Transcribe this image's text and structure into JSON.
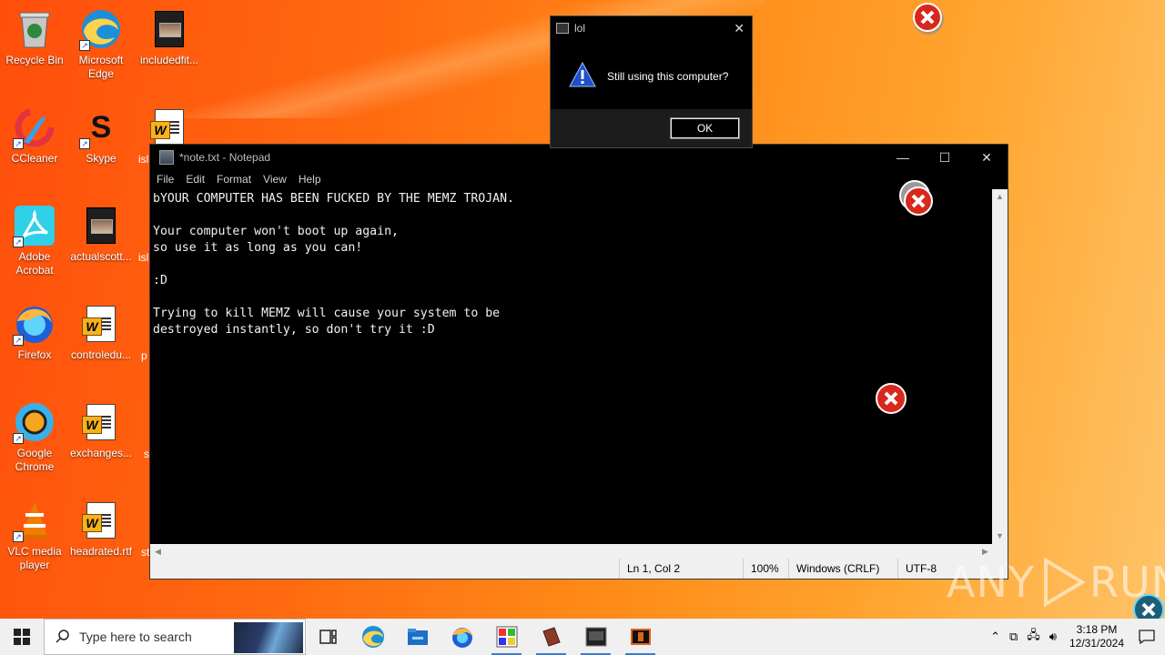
{
  "desktop": {
    "icons": [
      {
        "label": "Recycle Bin",
        "icon": "recycle-bin-icon"
      },
      {
        "label": "Microsoft Edge",
        "icon": "edge-icon"
      },
      {
        "label": "includedfit...",
        "icon": "image-file-icon"
      },
      {
        "label": "CCleaner",
        "icon": "ccleaner-icon"
      },
      {
        "label": "Skype",
        "icon": "skype-icon"
      },
      {
        "label": "isl",
        "icon": "word-doc-icon"
      },
      {
        "label": "Adobe Acrobat",
        "icon": "acrobat-icon"
      },
      {
        "label": "actualscott...",
        "icon": "image-file-icon"
      },
      {
        "label": "isl",
        "icon": "partial-icon"
      },
      {
        "label": "Firefox",
        "icon": "firefox-icon"
      },
      {
        "label": "controledu...",
        "icon": "word-doc-icon"
      },
      {
        "label": "p",
        "icon": "partial-icon"
      },
      {
        "label": "Google Chrome",
        "icon": "chrome-icon"
      },
      {
        "label": "exchanges...",
        "icon": "word-doc-icon"
      },
      {
        "label": "s",
        "icon": "partial-icon"
      },
      {
        "label": "VLC media player",
        "icon": "vlc-icon"
      },
      {
        "label": "headrated.rtf",
        "icon": "word-doc-icon"
      },
      {
        "label": "st",
        "icon": "partial-icon"
      }
    ]
  },
  "notepad": {
    "title": "*note.txt - Notepad",
    "menu": [
      "File",
      "Edit",
      "Format",
      "View",
      "Help"
    ],
    "content": "bYOUR COMPUTER HAS BEEN FUCKED BY THE MEMZ TROJAN.\n\nYour computer won't boot up again,\nso use it as long as you can!\n\n:D\n\nTrying to kill MEMZ will cause your system to be\ndestroyed instantly, so don't try it :D",
    "status": {
      "position": "Ln 1, Col 2",
      "zoom": "100%",
      "line_ending": "Windows (CRLF)",
      "encoding": "UTF-8"
    },
    "controls": {
      "minimize": "—",
      "maximize": "☐",
      "close": "✕"
    }
  },
  "dialog": {
    "title": "lol",
    "message": "Still using this computer?",
    "ok_label": "OK",
    "close": "✕"
  },
  "taskbar": {
    "search_placeholder": "Type here to search",
    "apps": [
      "task-view-icon",
      "edge-icon",
      "file-explorer-icon",
      "firefox-icon",
      "paint-icon",
      "winrar-icon",
      "terminal-icon",
      "memz-icon"
    ],
    "clock_time": "3:18 PM",
    "clock_date": "12/31/2024"
  },
  "watermark": {
    "text_left": "ANY",
    "text_right": "RUN"
  },
  "colors": {
    "error_red": "#d8281e",
    "warning_blue": "#1f4fc9"
  }
}
